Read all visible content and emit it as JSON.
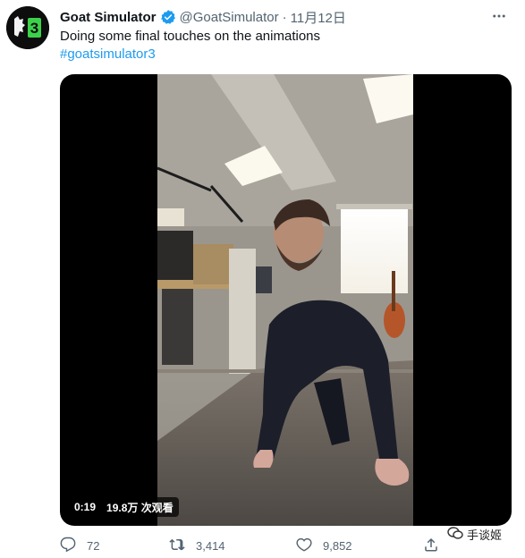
{
  "user": {
    "display_name": "Goat Simulator",
    "handle": "@GoatSimulator",
    "separator": "·",
    "time": "11月12日",
    "avatar_text": "3",
    "verified": true
  },
  "tweet": {
    "text": "Doing some final touches on the animations",
    "hashtag": "#goatsimulator3"
  },
  "video": {
    "duration": "0:19",
    "views": "19.8万 次观看"
  },
  "actions": {
    "replies": "72",
    "retweets": "3,414",
    "likes": "9,852"
  },
  "watermark": {
    "text": "手谈姬"
  },
  "colors": {
    "accent": "#1d9bf0",
    "muted": "#536471",
    "avatar_green": "#3cd14a"
  }
}
